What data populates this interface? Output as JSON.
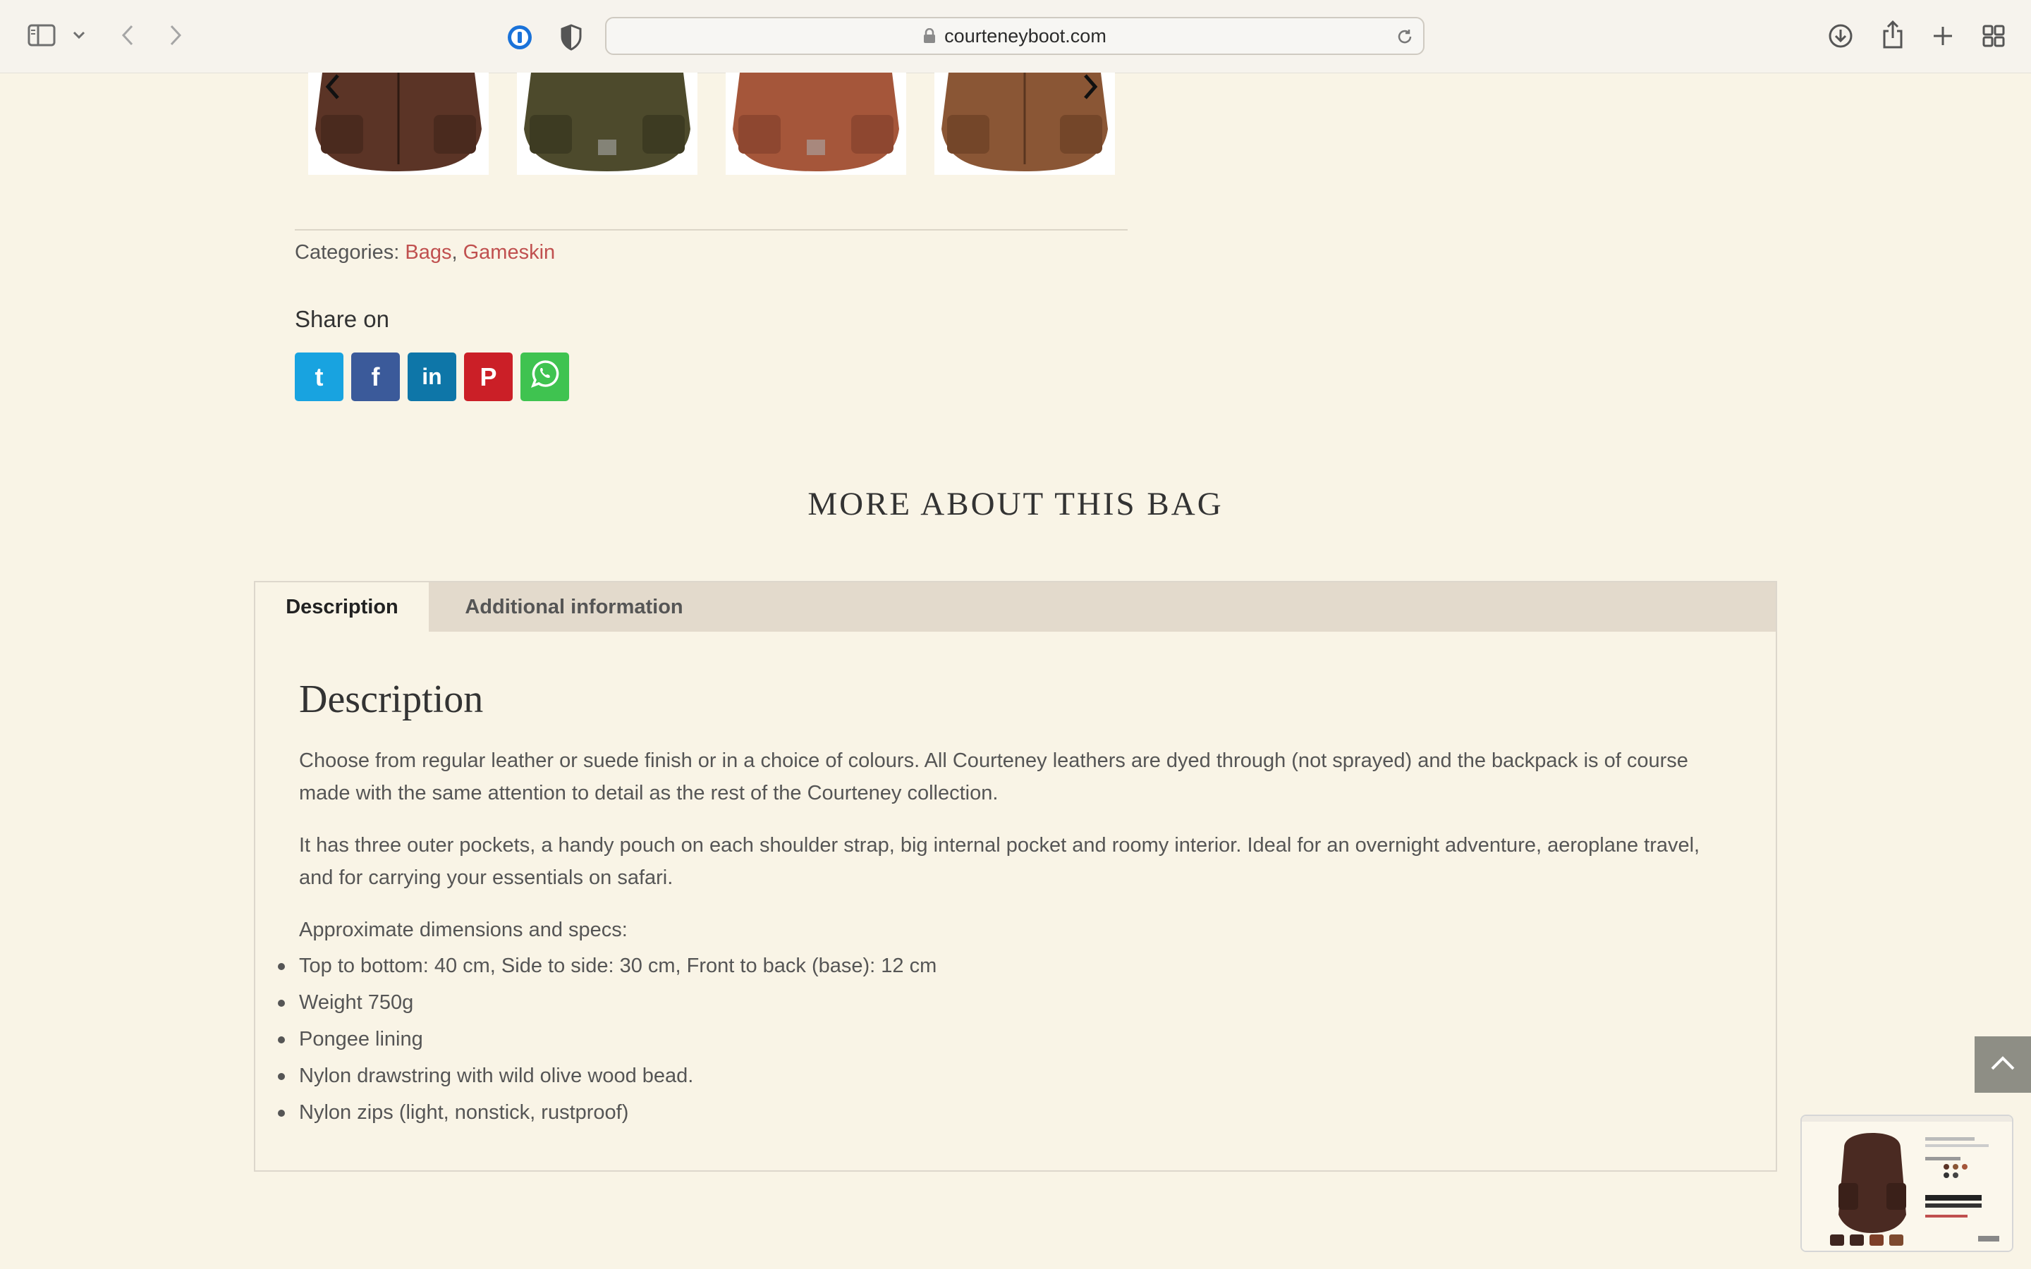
{
  "browser": {
    "url": "courteneyboot.com"
  },
  "product": {
    "categories_label": "Categories:",
    "categories": [
      "Bags",
      "Gameskin"
    ],
    "share_title": "Share on",
    "share_buttons": [
      {
        "network": "tumblr",
        "glyph": "t",
        "color": "#18a3e0"
      },
      {
        "network": "facebook",
        "glyph": "f",
        "color": "#3b5a9a"
      },
      {
        "network": "linkedin",
        "glyph": "in",
        "color": "#0e76a8"
      },
      {
        "network": "pinterest",
        "glyph": "P",
        "color": "#cb1f27"
      },
      {
        "network": "whatsapp",
        "glyph": "",
        "color": "#3fc350"
      }
    ],
    "thumbnail_colors": [
      "#5b3426",
      "#4d4a2c",
      "#a5563a",
      "#8a5635"
    ]
  },
  "section": {
    "title": "MORE ABOUT THIS BAG"
  },
  "tabs": [
    {
      "label": "Description",
      "active": true
    },
    {
      "label": "Additional information",
      "active": false
    }
  ],
  "description": {
    "heading": "Description",
    "paragraph1": "Choose from regular leather or suede finish or in a choice of colours. All Courteney leathers are dyed through (not sprayed) and the backpack is of course made with the same attention to detail as the rest of the Courteney collection.",
    "paragraph2": "It has three outer pockets, a handy pouch on each shoulder strap, big internal pocket and roomy interior. Ideal for an overnight adventure, aeroplane travel, and for carrying your essentials on safari.",
    "specs_intro": "Approximate dimensions and specs:",
    "specs": [
      "Top to bottom: 40 cm, Side to side: 30 cm,  Front to back (base): 12 cm",
      "Weight 750g",
      "Pongee lining",
      "Nylon drawstring with wild olive wood bead.",
      "Nylon zips (light, nonstick, rustproof)"
    ]
  },
  "colors": {
    "background": "#f9f4e6",
    "link": "#c0504f",
    "tab_strip": "#e3dacc"
  }
}
